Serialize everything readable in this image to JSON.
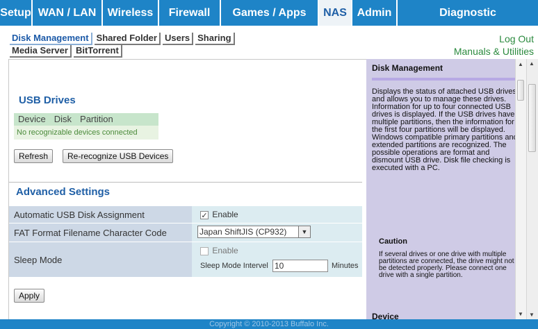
{
  "nav": {
    "tabs": [
      {
        "label": "Setup"
      },
      {
        "label": "WAN / LAN"
      },
      {
        "label": "Wireless"
      },
      {
        "label": "Firewall"
      },
      {
        "label": "Games / Apps"
      },
      {
        "label": "NAS"
      },
      {
        "label": "Admin"
      },
      {
        "label": "Diagnostic"
      }
    ],
    "active_tab": "NAS"
  },
  "subnav": {
    "row1": [
      {
        "label": "Disk Management"
      },
      {
        "label": "Shared Folder"
      },
      {
        "label": "Users"
      },
      {
        "label": "Sharing"
      }
    ],
    "row2": [
      {
        "label": "Media Server"
      },
      {
        "label": "BitTorrent"
      }
    ],
    "active": "Disk Management"
  },
  "links": {
    "logout": "Log Out",
    "manuals": "Manuals & Utilities"
  },
  "usb": {
    "title": "USB Drives",
    "columns": [
      "Device",
      "Disk",
      "Partition"
    ],
    "empty_message": "No recognizable devices connected",
    "refresh_label": "Refresh",
    "rerecognize_label": "Re-recognize USB Devices"
  },
  "advanced": {
    "title": "Advanced Settings",
    "auto_label": "Automatic USB Disk Assignment",
    "auto_enable_label": "Enable",
    "auto_checked": true,
    "fat_label": "FAT Format Filename Character Code",
    "fat_value": "Japan ShiftJIS (CP932)",
    "sleep_label": "Sleep Mode",
    "sleep_enable_label": "Enable",
    "sleep_checked": false,
    "sleep_interval_label": "Sleep Mode Intervel",
    "sleep_interval_value": "10",
    "sleep_interval_unit": "Minutes",
    "apply_label": "Apply"
  },
  "help": {
    "title": "Disk Management",
    "paragraph1": "Displays the status of attached USB drives and allows you to manage these drives. Information for up to four connected USB drives is displayed. If the USB drives have multiple partitions, then the information for the first four partitions will be displayed. Windows compatible primary partitions and extended partitions are recognized. The possible operations are format and dismount USB drive. Disk file checking is executed with a PC.",
    "caution_title": "Caution",
    "caution_text": "If several drives or one drive with multiple partitions are connected, the drive might not be detected properly. Please connect one drive with a single partition.",
    "device_heading": "Device"
  },
  "footer": {
    "copyright": "Copyright © 2010-2013 Buffalo Inc."
  },
  "colors": {
    "nav_blue": "#1e84c7",
    "link_green": "#2b8a3e",
    "heading_blue": "#1f5fa6",
    "help_bg": "#cfcbe6"
  }
}
